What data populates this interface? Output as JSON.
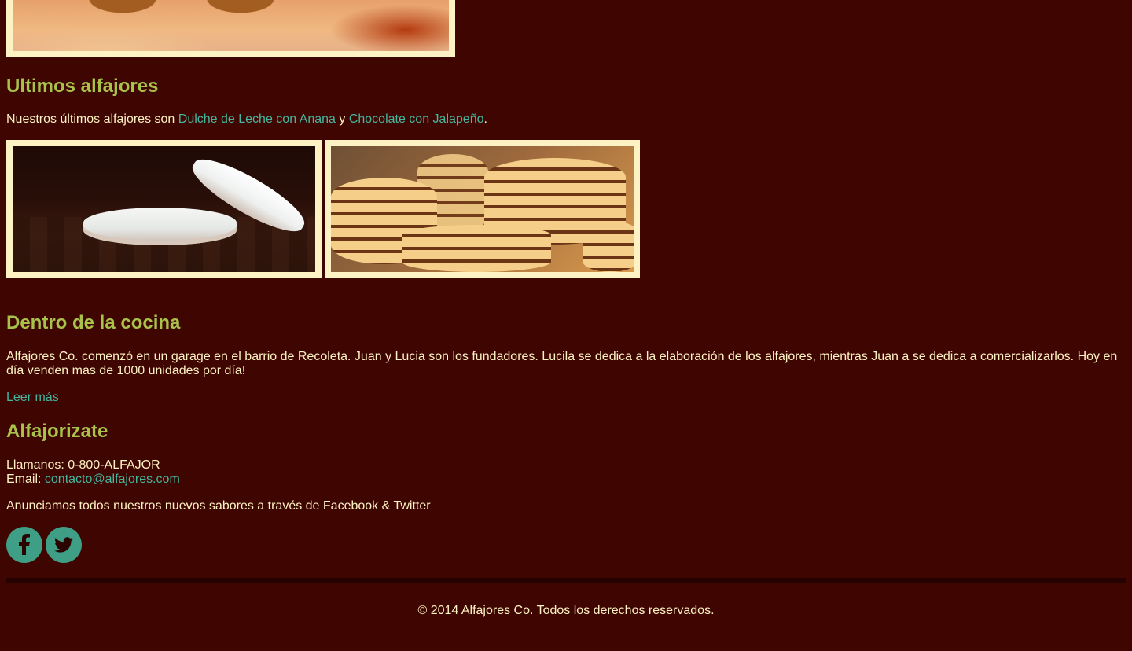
{
  "sections": {
    "latest": {
      "heading": "Ultimos alfajores",
      "intro": "Nuestros últimos alfajores son ",
      "link1": "Dulche de Leche con Anana",
      "conj": " y ",
      "link2": "Chocolate con Jalapeño",
      "end": "."
    },
    "kitchen": {
      "heading": "Dentro de la cocina",
      "body": "Alfajores Co. comenzó en un garage en el barrio de Recoleta. Juan y Lucia son los fundadores. Lucila se dedica a la elaboración de los alfajores, mientras Juan a se dedica a comercializarlos. Hoy en día venden mas de 1000 unidades por día!",
      "read_more": "Leer más"
    },
    "contact": {
      "heading": "Alfajorizate",
      "phone_label": "Llamanos: 0-800-ALFAJOR",
      "email_label": "Email: ",
      "email": "contacto@alfajores.com",
      "announce": "Anunciamos todos nuestros nuevos sabores a través de Facebook & Twitter"
    }
  },
  "social": [
    {
      "name": "facebook-icon"
    },
    {
      "name": "twitter-icon"
    }
  ],
  "footer": {
    "copyright": "© 2014 Alfajores Co. Todos los derechos reservados."
  },
  "colors": {
    "background": "#3f0500",
    "heading": "#a8c24a",
    "text": "#fdf2c3",
    "link": "#46b6a0",
    "frame": "#fdf2c3",
    "social": "#3e9e86"
  }
}
